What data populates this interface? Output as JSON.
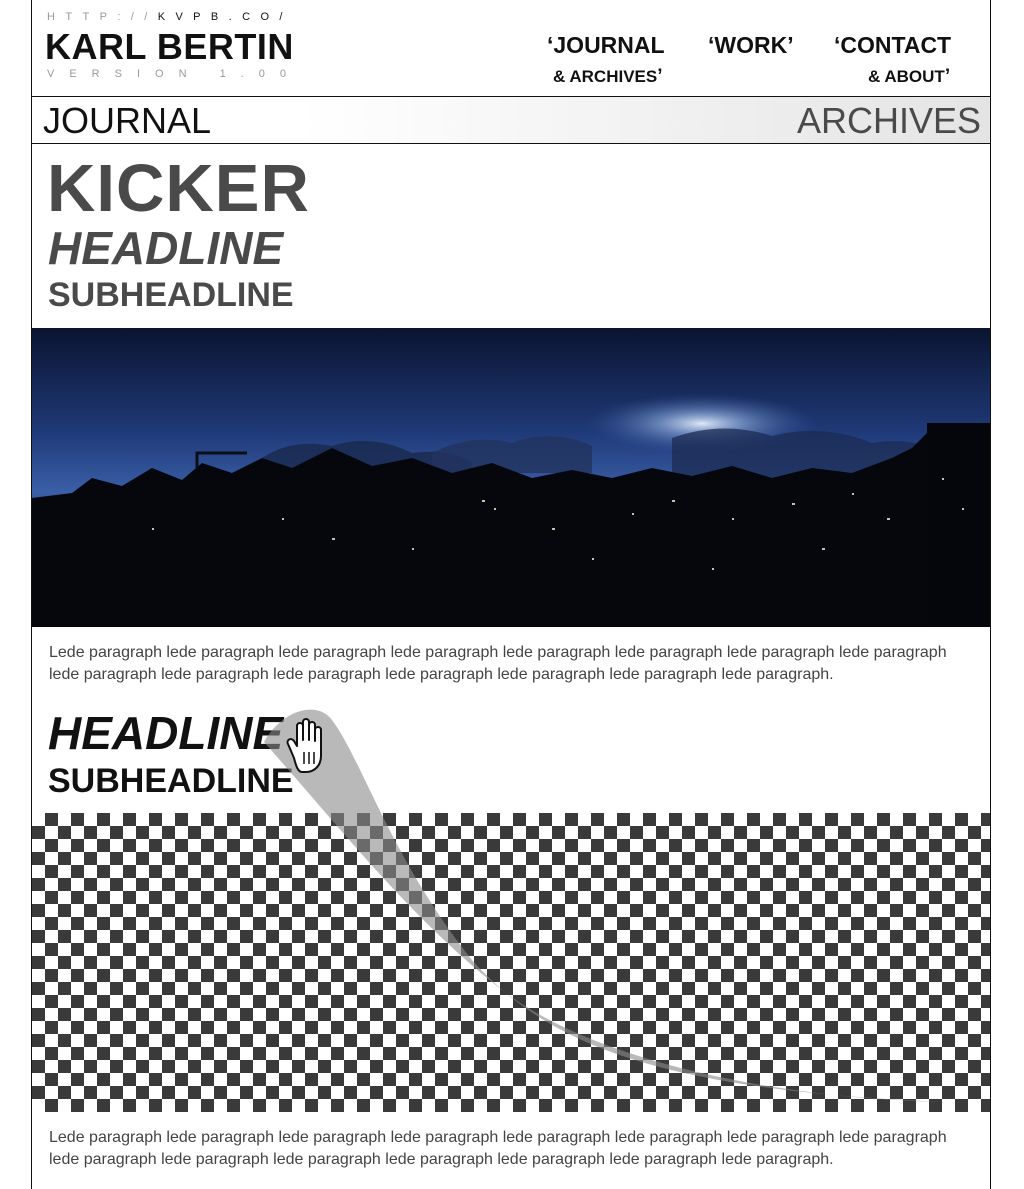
{
  "header": {
    "url_prefix": "HTTP://",
    "url_domain": "KVPB.CO/",
    "site_name": "KARL BERTIN",
    "version": "VERSION 1.00"
  },
  "nav": {
    "journal": {
      "main": "‘JOURNAL",
      "sub": "& ARCHIVES",
      "close_quote": "’"
    },
    "work": {
      "main": "‘WORK’"
    },
    "contact": {
      "main": "‘CONTACT",
      "sub": "& ABOUT",
      "close_quote": "’"
    }
  },
  "section_bar": {
    "left": "JOURNAL",
    "right": "ARCHIVES"
  },
  "article_1": {
    "kicker": "KICKER",
    "headline": "HEADLINE",
    "subheadline": "SUBHEADLINE",
    "image_icon": "night-skyline-photo",
    "lede": "Lede paragraph lede paragraph lede paragraph lede paragraph lede paragraph lede paragraph lede paragraph lede paragraph lede paragraph lede paragraph lede paragraph lede paragraph lede paragraph lede paragraph lede paragraph."
  },
  "article_2": {
    "headline": "HEADLINE",
    "subheadline": "SUBHEADLINE",
    "image_icon": "transparent-checkerboard-placeholder",
    "lede": "Lede paragraph lede paragraph lede paragraph lede paragraph lede paragraph lede paragraph lede paragraph lede paragraph lede paragraph lede paragraph lede paragraph lede paragraph lede paragraph lede paragraph lede paragraph."
  },
  "cursor": {
    "icon": "grab-hand-cursor-icon"
  },
  "colors": {
    "text_dark": "#111111",
    "text_grey": "#4a4a4a",
    "lede_text": "#444444",
    "muted": "#9a9a9a",
    "checker_dark": "#3a3a3a"
  }
}
